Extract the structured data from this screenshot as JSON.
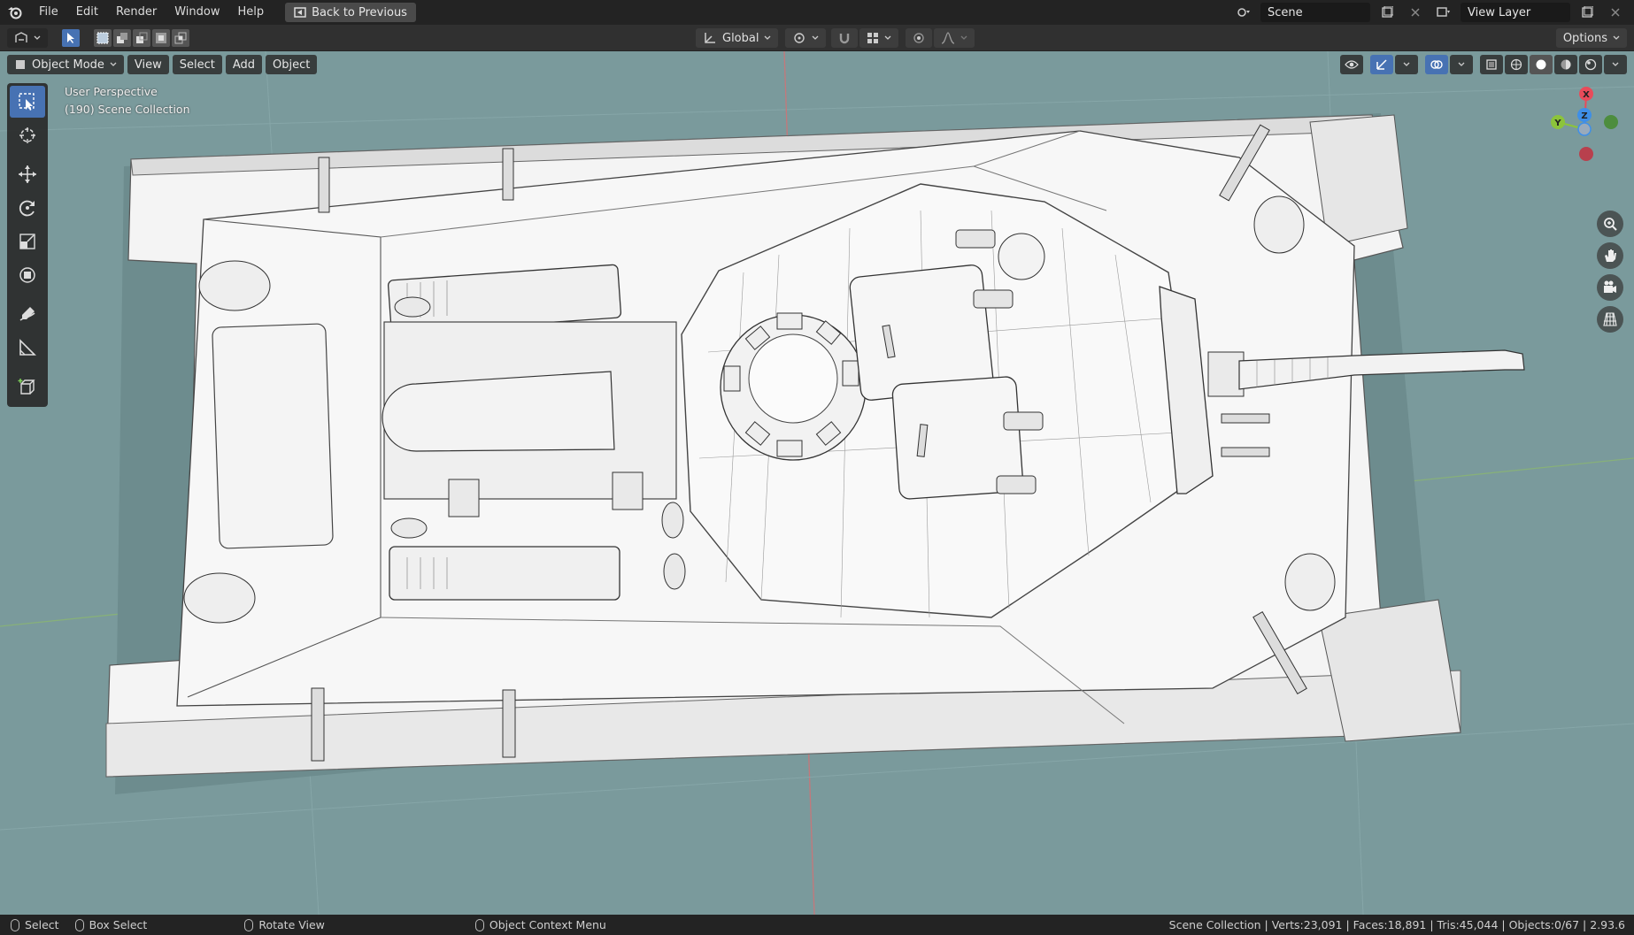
{
  "app": {
    "name": "Blender"
  },
  "menubar": {
    "items": [
      "File",
      "Edit",
      "Render",
      "Window",
      "Help"
    ],
    "back_button": "Back to Previous"
  },
  "topright": {
    "scene_label": "Scene",
    "view_layer_label": "View Layer"
  },
  "header": {
    "transform_orientation": "Global",
    "options_label": "Options"
  },
  "viewport": {
    "mode": "Object Mode",
    "menus": [
      "View",
      "Select",
      "Add",
      "Object"
    ],
    "perspective_label": "User Perspective",
    "collection_label": "(190) Scene Collection",
    "background_color": "#7a9a9c",
    "gizmo": {
      "x": "X",
      "y": "Y",
      "z": "Z"
    }
  },
  "tools": [
    "select-box",
    "cursor",
    "move",
    "rotate",
    "scale",
    "transform",
    "annotate",
    "measure",
    "add-cube"
  ],
  "statusbar": {
    "select": "Select",
    "box_select": "Box Select",
    "rotate_view": "Rotate View",
    "context_menu": "Object Context Menu",
    "stats": "Scene Collection | Verts:23,091 | Faces:18,891 | Tris:45,044 | Objects:0/67 | 2.93.6"
  },
  "colors": {
    "accent": "#4772b3",
    "axis_x": "#e84b5a",
    "axis_y": "#8cc43b",
    "axis_z": "#3e8fe8"
  }
}
